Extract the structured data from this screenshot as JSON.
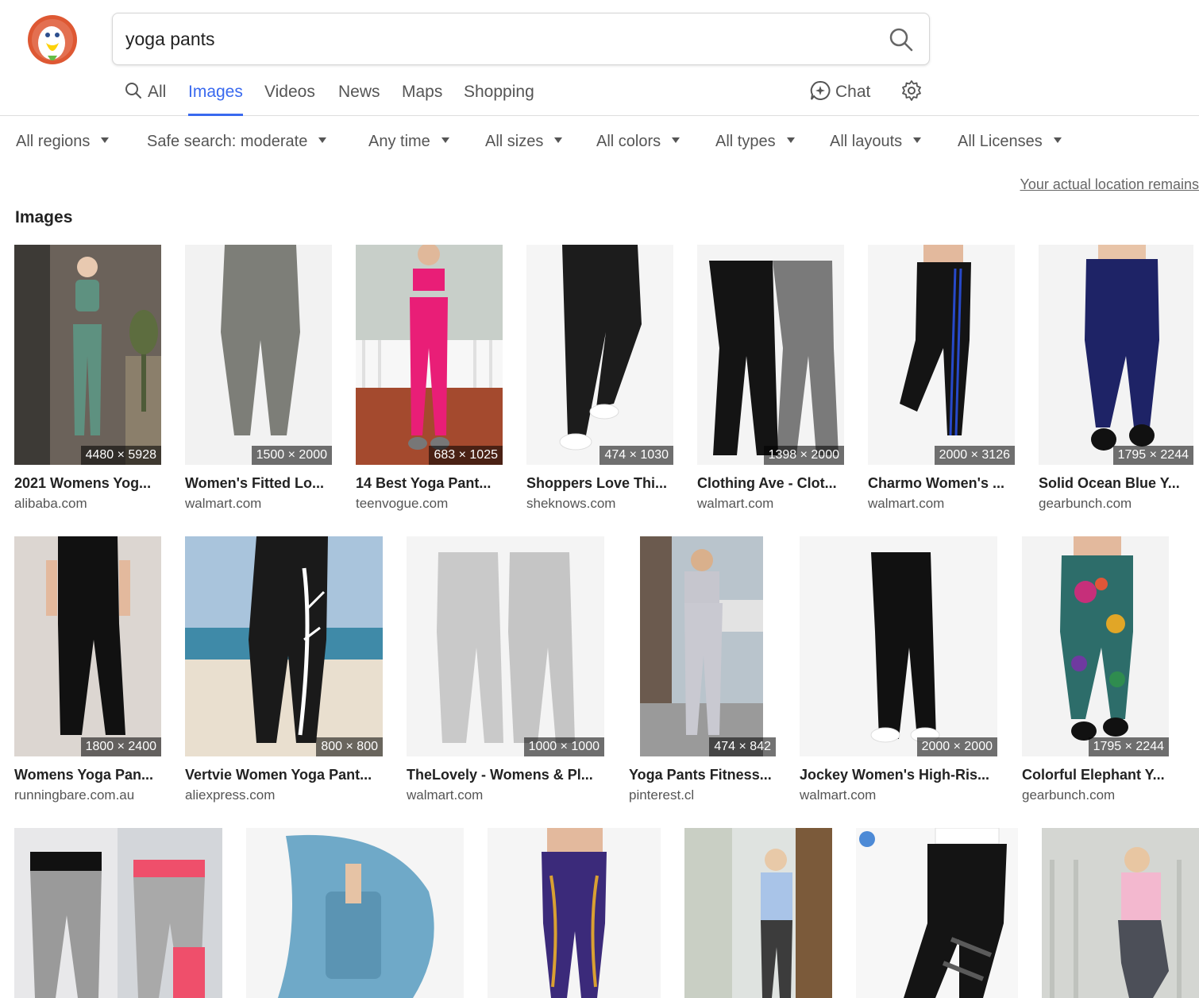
{
  "search": {
    "query": "yoga pants"
  },
  "nav": {
    "tabs": [
      {
        "label": "All",
        "icon": "search-icon",
        "active": false
      },
      {
        "label": "Images",
        "active": true
      },
      {
        "label": "Videos",
        "active": false
      },
      {
        "label": "News",
        "active": false
      },
      {
        "label": "Maps",
        "active": false
      },
      {
        "label": "Shopping",
        "active": false
      }
    ],
    "chat_label": "Chat"
  },
  "filters": [
    "All regions",
    "Safe search: moderate",
    "Any time",
    "All sizes",
    "All colors",
    "All types",
    "All layouts",
    "All Licenses"
  ],
  "location_note": "Your actual location remains",
  "section_title": "Images",
  "colors": {
    "accent": "#3969ef",
    "logo": "#de5833"
  },
  "results": [
    {
      "title": "2021 Womens Yog...",
      "source": "alibaba.com",
      "dims": "4480 × 5928"
    },
    {
      "title": "Women's Fitted Lo...",
      "source": "walmart.com",
      "dims": "1500 × 2000"
    },
    {
      "title": "14 Best Yoga Pant...",
      "source": "teenvogue.com",
      "dims": "683 × 1025"
    },
    {
      "title": "Shoppers Love Thi...",
      "source": "sheknows.com",
      "dims": "474 × 1030"
    },
    {
      "title": "Clothing Ave - Clot...",
      "source": "walmart.com",
      "dims": "1398 × 2000"
    },
    {
      "title": "Charmo Women's ...",
      "source": "walmart.com",
      "dims": "2000 × 3126"
    },
    {
      "title": "Solid Ocean Blue Y...",
      "source": "gearbunch.com",
      "dims": "1795 × 2244"
    },
    {
      "title": "Womens Yoga Pan...",
      "source": "runningbare.com.au",
      "dims": "1800 × 2400"
    },
    {
      "title": "Vertvie Women Yoga Pant...",
      "source": "aliexpress.com",
      "dims": "800 × 800"
    },
    {
      "title": "TheLovely - Womens & Pl...",
      "source": "walmart.com",
      "dims": "1000 × 1000"
    },
    {
      "title": "Yoga Pants Fitness...",
      "source": "pinterest.cl",
      "dims": "474 × 842"
    },
    {
      "title": "Jockey Women's High-Ris...",
      "source": "walmart.com",
      "dims": "2000 × 2000"
    },
    {
      "title": "Colorful Elephant Y...",
      "source": "gearbunch.com",
      "dims": "1795 × 2244"
    }
  ]
}
